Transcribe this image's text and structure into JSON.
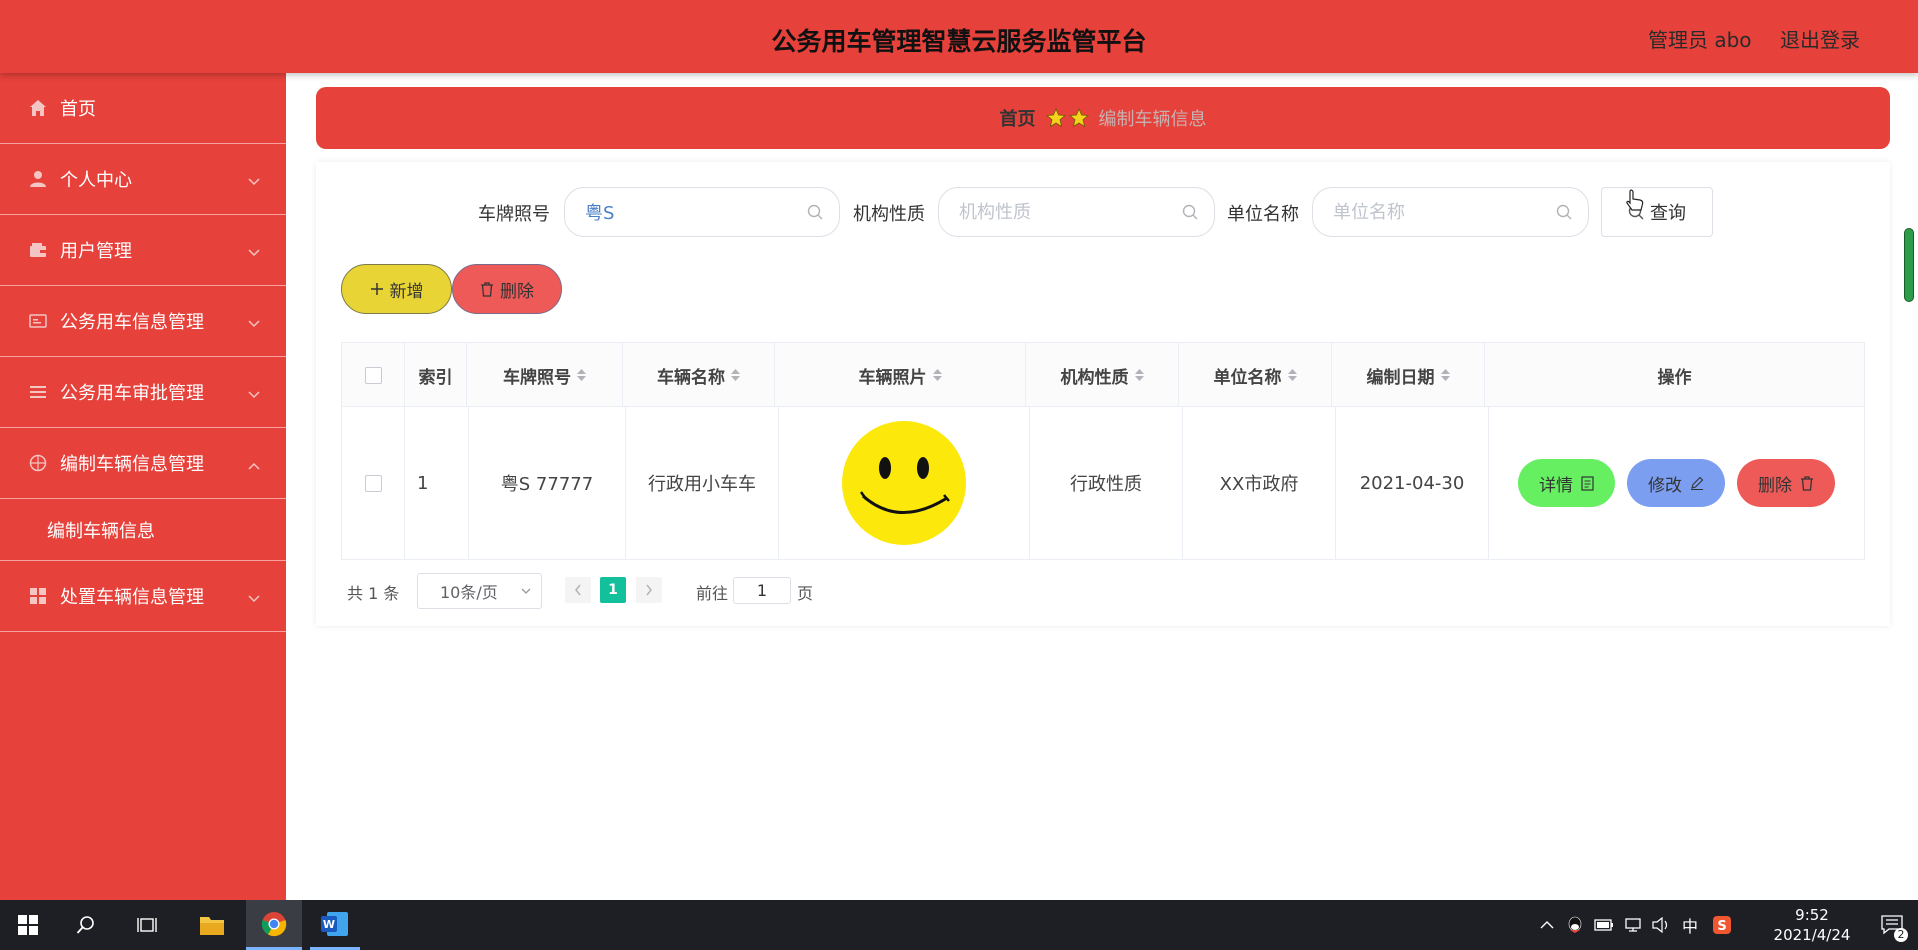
{
  "header": {
    "title": "公务用车管理智慧云服务监管平台",
    "user": "管理员 abo",
    "logout": "退出登录"
  },
  "sidebar": {
    "items": [
      {
        "label": "首页",
        "icon": "home-icon"
      },
      {
        "label": "个人中心",
        "icon": "user-icon"
      },
      {
        "label": "用户管理",
        "icon": "wallet-icon"
      },
      {
        "label": "公务用车信息管理",
        "icon": "card-icon"
      },
      {
        "label": "公务用车审批管理",
        "icon": "list-icon"
      },
      {
        "label": "编制车辆信息管理",
        "icon": "target-icon"
      },
      {
        "label": "处置车辆信息管理",
        "icon": "grid-icon"
      }
    ],
    "sub_item": "编制车辆信息"
  },
  "breadcrumb": {
    "home": "首页",
    "current": "编制车辆信息"
  },
  "search": {
    "plate_label": "车牌照号",
    "plate_value": "粤S",
    "org_label": "机构性质",
    "org_placeholder": "机构性质",
    "unit_label": "单位名称",
    "unit_placeholder": "单位名称",
    "query_button": "查询"
  },
  "toolbar": {
    "add_label": "新增",
    "delete_label": "删除"
  },
  "table": {
    "columns": [
      "索引",
      "车牌照号",
      "车辆名称",
      "车辆照片",
      "机构性质",
      "单位名称",
      "编制日期",
      "操作"
    ],
    "rows": [
      {
        "index": "1",
        "plate": "粤S 77777",
        "name": "行政用小车车",
        "org": "行政性质",
        "unit": "XX市政府",
        "date": "2021-04-30"
      }
    ],
    "actions": {
      "detail": "详情",
      "edit": "修改",
      "delete": "删除"
    }
  },
  "pagination": {
    "total": "共 1 条",
    "page_size": "10条/页",
    "current_page": "1",
    "goto_label": "前往",
    "goto_value": "1",
    "page_suffix": "页"
  },
  "taskbar": {
    "time": "9:52",
    "date": "2021/4/24",
    "ime": "中",
    "notifications": "2"
  },
  "colors": {
    "brand_red": "#e6413b",
    "add_yellow": "#e8d434",
    "detail_green": "#66f061",
    "edit_blue": "#7b9ef0",
    "delete_red": "#ee5a58",
    "page_active": "#13c09c"
  }
}
